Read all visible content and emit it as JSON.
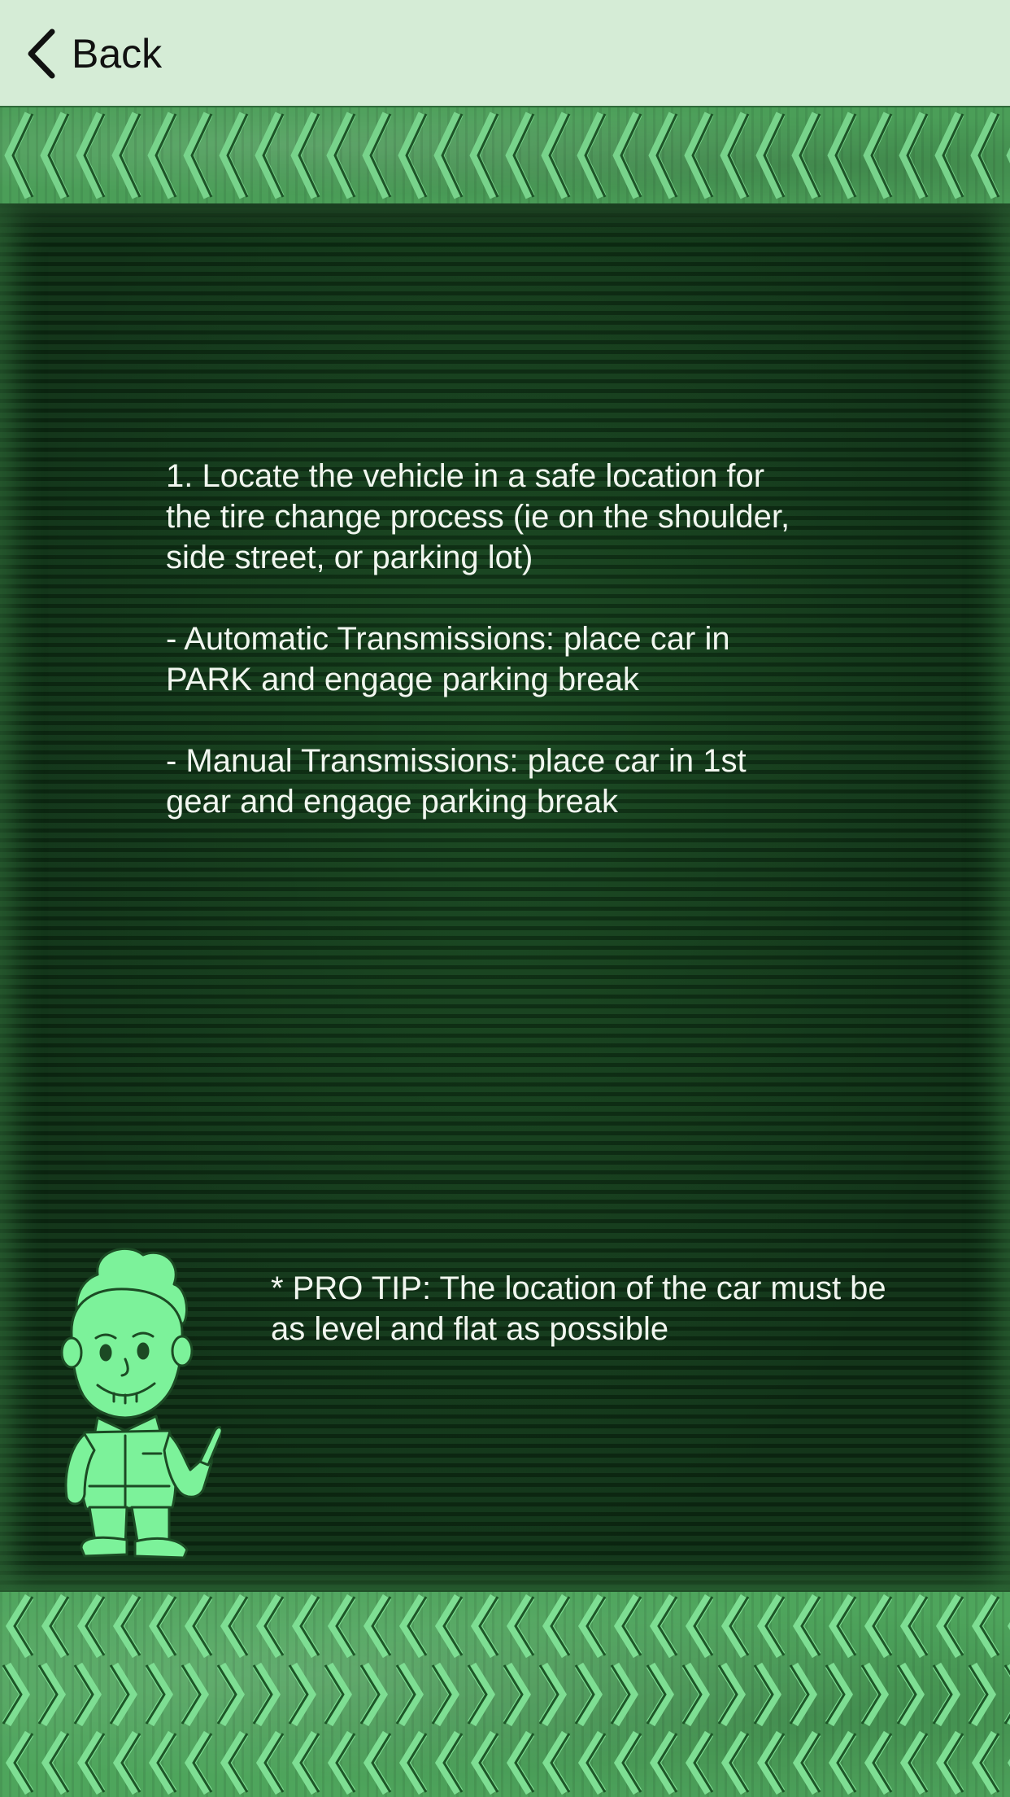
{
  "nav": {
    "back_label": "Back",
    "back_icon": "chevron-left-icon"
  },
  "content": {
    "step_text": "1. Locate the vehicle in a safe location for\nthe tire change process (ie on the shoulder,\nside street, or parking lot)\n\n- Automatic Transmissions: place car in\nPARK and engage parking break\n\n- Manual Transmissions: place car in 1st\ngear and engage parking break",
    "tip_text": "* PRO TIP: The location of the car must be\nas level and flat as possible"
  },
  "colors": {
    "nav_bg": "#d5ecd6",
    "screen_bg": "#0f3216",
    "tread": "#57b466",
    "text": "#f1f6ef",
    "mascot": "#7cf29a"
  },
  "decor": {
    "mascot": "mascot-illustration",
    "tread": "chevron-tread-pattern"
  }
}
